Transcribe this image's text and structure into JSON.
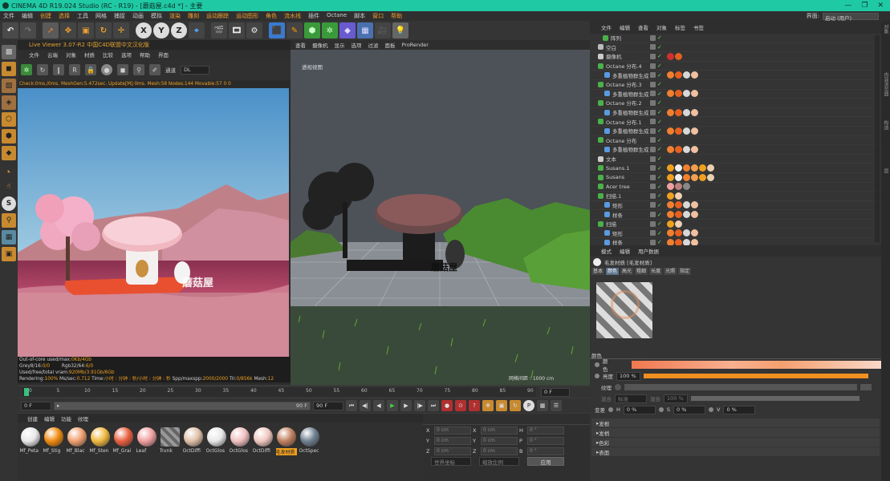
{
  "window": {
    "title": "CINEMA 4D R19.024 Studio (RC - R19) - [蘑菇屋.c4d *] - 主要",
    "controls": [
      "—",
      "❐",
      "✕"
    ]
  },
  "menubar": {
    "items": [
      "文件",
      "编辑",
      "创建",
      "选择",
      "工具",
      "网格",
      "捕捉",
      "动画",
      "模拟",
      "渲染",
      "雕刻",
      "运动跟踪",
      "运动图形",
      "角色",
      "流水线",
      "插件",
      "Octane",
      "脚本",
      "窗口",
      "帮助"
    ],
    "highlight_indices": [
      2,
      3,
      9,
      10,
      11,
      12,
      13,
      14,
      18,
      19
    ],
    "layout_label": "界面:",
    "layout_value": "启动 (用户)"
  },
  "live_viewer": {
    "title": "Live Viewer 3.07-R2 中国C4D联盟中文汉化版",
    "menu": [
      "文件",
      "云端",
      "对象",
      "材质",
      "比较",
      "选项",
      "帮助",
      "界面"
    ],
    "channel_label": "通道",
    "channel_value": "DL",
    "status": "Check:0ms./0ms. MeshGen:5.472sec. Update[M]:0ms. Mesh:58 Nodes:144 Movable:57 0 0",
    "scene_text": "蘑菇屋",
    "info": {
      "l1_label": "Out-of-core used/max:",
      "l1_val": "0Kb/4Gb",
      "l2_label": "Grey8/16:",
      "l2_val": "0/0",
      "l2b_label": "Rgb32/64:",
      "l2b_val": "6/0",
      "l3_label": "Used/free/total vram:",
      "l3_val": "920Mb/3.91Gb/6Gb",
      "l4_label": "Rendering:",
      "l4_val": "100%",
      "l4b_label": "Ms/sec:",
      "l4b_val": "0.712",
      "l4c_label": "Time:",
      "l4c_val": "小时 : 分钟 : 秒/小时 : 分钟 : 秒",
      "l4d_label": "Spp/maxspp:",
      "l4d_val": "2000/2000",
      "l4e_label": "Tri:",
      "l4e_val": "0/856k",
      "l4f_label": "Mesh:",
      "l4f_val": "12"
    }
  },
  "viewport": {
    "menu": [
      "查看",
      "摄像机",
      "显示",
      "选项",
      "过滤",
      "面板",
      "ProRender"
    ],
    "label": "透视视图",
    "scene_text": "蘑菇屋",
    "grid_spacing": "网格间距 : 1000 cm"
  },
  "timeline": {
    "ticks": [
      "0",
      "5",
      "10",
      "15",
      "20",
      "25",
      "30",
      "35",
      "40",
      "45",
      "50",
      "55",
      "60",
      "65",
      "70",
      "75",
      "80",
      "85",
      "90"
    ],
    "end_field": "0 F"
  },
  "transport": {
    "start": "0 F",
    "start_arrow": "▸",
    "range_end": "90 F",
    "end": "90 F"
  },
  "materials": {
    "menu": [
      "创建",
      "编辑",
      "功能",
      "纹理"
    ],
    "items": [
      {
        "label": "Mf_Peta",
        "color": "#e8e8e8"
      },
      {
        "label": "Mf_Stig",
        "color": "#f08a10"
      },
      {
        "label": "Mf_Blac",
        "color": "#f0a070"
      },
      {
        "label": "Mf_Sten",
        "color": "#f0b840"
      },
      {
        "label": "Mf_Grai",
        "color": "#e86040"
      },
      {
        "label": "Leaf",
        "color": "#f0a0a0"
      },
      {
        "label": "Trunk",
        "color": "#888888"
      },
      {
        "label": "OctDiffi",
        "color": "#e0c0a8"
      },
      {
        "label": "OctGlos",
        "color": "#e8e8e8"
      },
      {
        "label": "OctGlos",
        "color": "#f0c0c0"
      },
      {
        "label": "OctDiffi",
        "color": "#f0c8c0"
      },
      {
        "label": "毛发材质",
        "color": "#c08060"
      },
      {
        "label": "OctSpec",
        "color": "#708090"
      }
    ]
  },
  "coords": {
    "rows": [
      {
        "a": "X",
        "av": "0 cm",
        "b": "X",
        "bv": "0 cm",
        "c": "H",
        "cv": "0 °"
      },
      {
        "a": "Y",
        "av": "0 cm",
        "b": "Y",
        "bv": "0 cm",
        "c": "P",
        "cv": "0 °"
      },
      {
        "a": "Z",
        "av": "0 cm",
        "b": "Z",
        "bv": "0 cm",
        "c": "B",
        "cv": "0 °"
      }
    ],
    "mode1": "世界坐标",
    "mode2": "缩放比例",
    "apply": "应用"
  },
  "object_manager": {
    "menu": [
      "文件",
      "编辑",
      "查看",
      "对象",
      "标签",
      "书签"
    ],
    "rows": [
      {
        "name": "阵列",
        "indent": 16,
        "icon": "#4ab04a"
      },
      {
        "name": "空白",
        "indent": 10,
        "icon": "#bbbbbb"
      },
      {
        "name": "摄像机",
        "indent": 10,
        "icon": "#cccccc"
      },
      {
        "name": "Octane 分布.4",
        "indent": 10,
        "icon": "#4ab04a"
      },
      {
        "name": "多重植物群生成",
        "indent": 18,
        "icon": "#5a9ae0"
      },
      {
        "name": "Octane 分布.3",
        "indent": 10,
        "icon": "#4ab04a"
      },
      {
        "name": "多重植物群生成",
        "indent": 18,
        "icon": "#5a9ae0"
      },
      {
        "name": "Octane 分布.2",
        "indent": 10,
        "icon": "#4ab04a"
      },
      {
        "name": "多重植物群生成",
        "indent": 18,
        "icon": "#5a9ae0"
      },
      {
        "name": "Octane 分布.1",
        "indent": 10,
        "icon": "#4ab04a"
      },
      {
        "name": "多重植物群生成",
        "indent": 18,
        "icon": "#5a9ae0"
      },
      {
        "name": "Octane 分布",
        "indent": 10,
        "icon": "#4ab04a"
      },
      {
        "name": "多重植物群生成",
        "indent": 18,
        "icon": "#5a9ae0"
      },
      {
        "name": "文本",
        "indent": 10,
        "icon": "#cccccc"
      },
      {
        "name": "Susans.1",
        "indent": 10,
        "icon": "#4ab04a"
      },
      {
        "name": "Susans",
        "indent": 10,
        "icon": "#4ab04a"
      },
      {
        "name": "Acer tree",
        "indent": 10,
        "icon": "#4ab04a"
      },
      {
        "name": "扫描.1",
        "indent": 10,
        "icon": "#4ab04a"
      },
      {
        "name": "矩形",
        "indent": 18,
        "icon": "#5a9ae0"
      },
      {
        "name": "样条",
        "indent": 18,
        "icon": "#5a9ae0"
      },
      {
        "name": "扫描",
        "indent": 10,
        "icon": "#4ab04a"
      },
      {
        "name": "矩形",
        "indent": 18,
        "icon": "#5a9ae0"
      },
      {
        "name": "样条",
        "indent": 18,
        "icon": "#5a9ae0"
      }
    ]
  },
  "attribute_manager": {
    "menu": [
      "模式",
      "编辑",
      "用户数据"
    ],
    "title": "毛发材质 [毛发材质]",
    "tabs": [
      "基本",
      "颜色",
      "高光",
      "粗细",
      "长度",
      "光照",
      "指定"
    ],
    "active_tab": 1,
    "section": "颜色",
    "color_label": "颜色",
    "brightness_label": "亮度",
    "brightness_value": "100 %",
    "texture_label": "纹理",
    "blend_label": "混合",
    "blend_mode": "标准",
    "mix_label": "混合",
    "mix_value": "100 %",
    "variation_label": "变差",
    "h_label": "H",
    "h_value": "0 %",
    "s_label": "S",
    "s_value": "0 %",
    "v_label": "V",
    "v_value": "0 %",
    "sections": [
      "发根",
      "发梢",
      "色彩",
      "表面"
    ]
  },
  "right_strip": [
    "对象",
    "内容浏览器",
    "构造",
    "层"
  ]
}
